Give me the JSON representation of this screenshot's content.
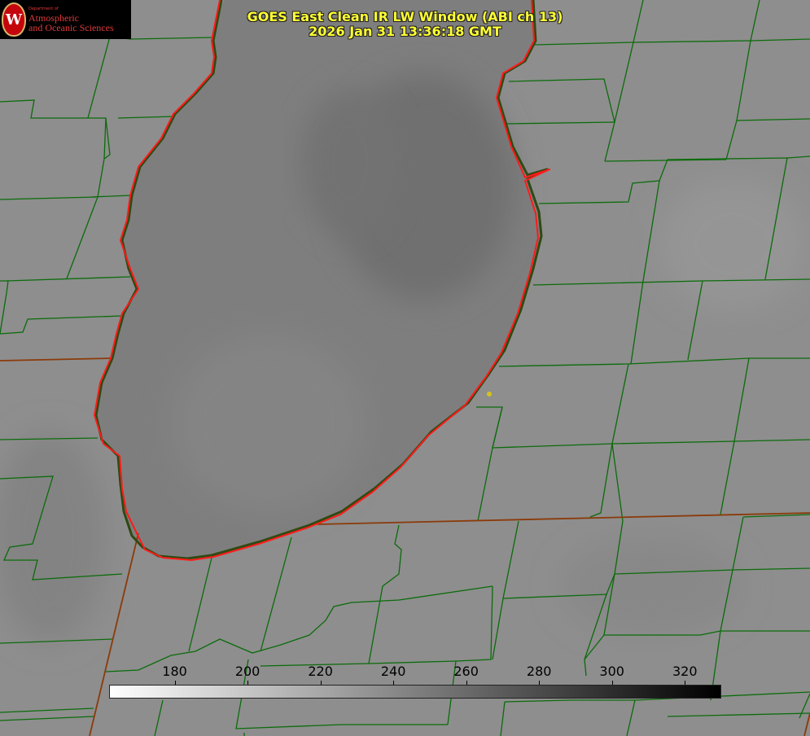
{
  "title_line1": "GOES East Clean IR LW Window (ABI ch 13)",
  "title_line2": "2026 Jan 31 13:36:18 GMT",
  "logo": {
    "dept": "Department of",
    "line1": "Atmospheric",
    "line2": "and Oceanic Sciences",
    "seal_letter": "W"
  },
  "colorbar": {
    "min": 162,
    "max": 330,
    "ticks": [
      180,
      200,
      220,
      240,
      260,
      280,
      300,
      320
    ],
    "colors": {
      "low": "#ffffff",
      "high": "#000000"
    }
  },
  "map_colors": {
    "county_border": "#0b6b0b",
    "state_border": "#8b3a0a",
    "shoreline": "#ff1a1a",
    "marker": "#d6c21a",
    "background": "#8e8e8e"
  }
}
